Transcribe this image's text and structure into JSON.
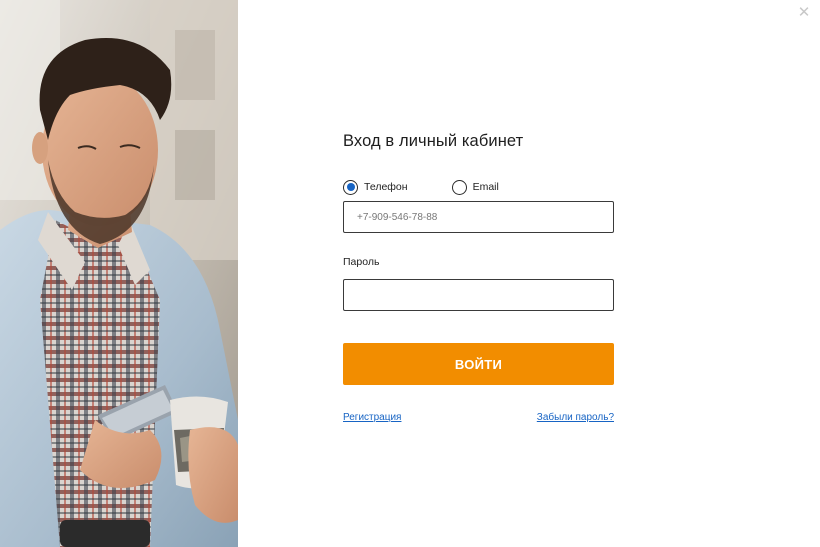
{
  "modal": {
    "close_icon": "close-icon",
    "title": "Вход в личный кабинет",
    "login_type": {
      "options": [
        {
          "label": "Телефон",
          "selected": true
        },
        {
          "label": "Email",
          "selected": false
        }
      ]
    },
    "phone": {
      "placeholder": "+7-909-546-78-88",
      "value": ""
    },
    "password": {
      "label": "Пароль",
      "value": ""
    },
    "submit_label": "ВОЙТИ",
    "links": {
      "register": "Регистрация",
      "forgot": "Забыли пароль?"
    },
    "colors": {
      "accent": "#f28d00",
      "link": "#1764c4",
      "radio_selected": "#1764c4"
    }
  },
  "side_image": {
    "subject": "man-with-phone-and-coffee-cup"
  }
}
